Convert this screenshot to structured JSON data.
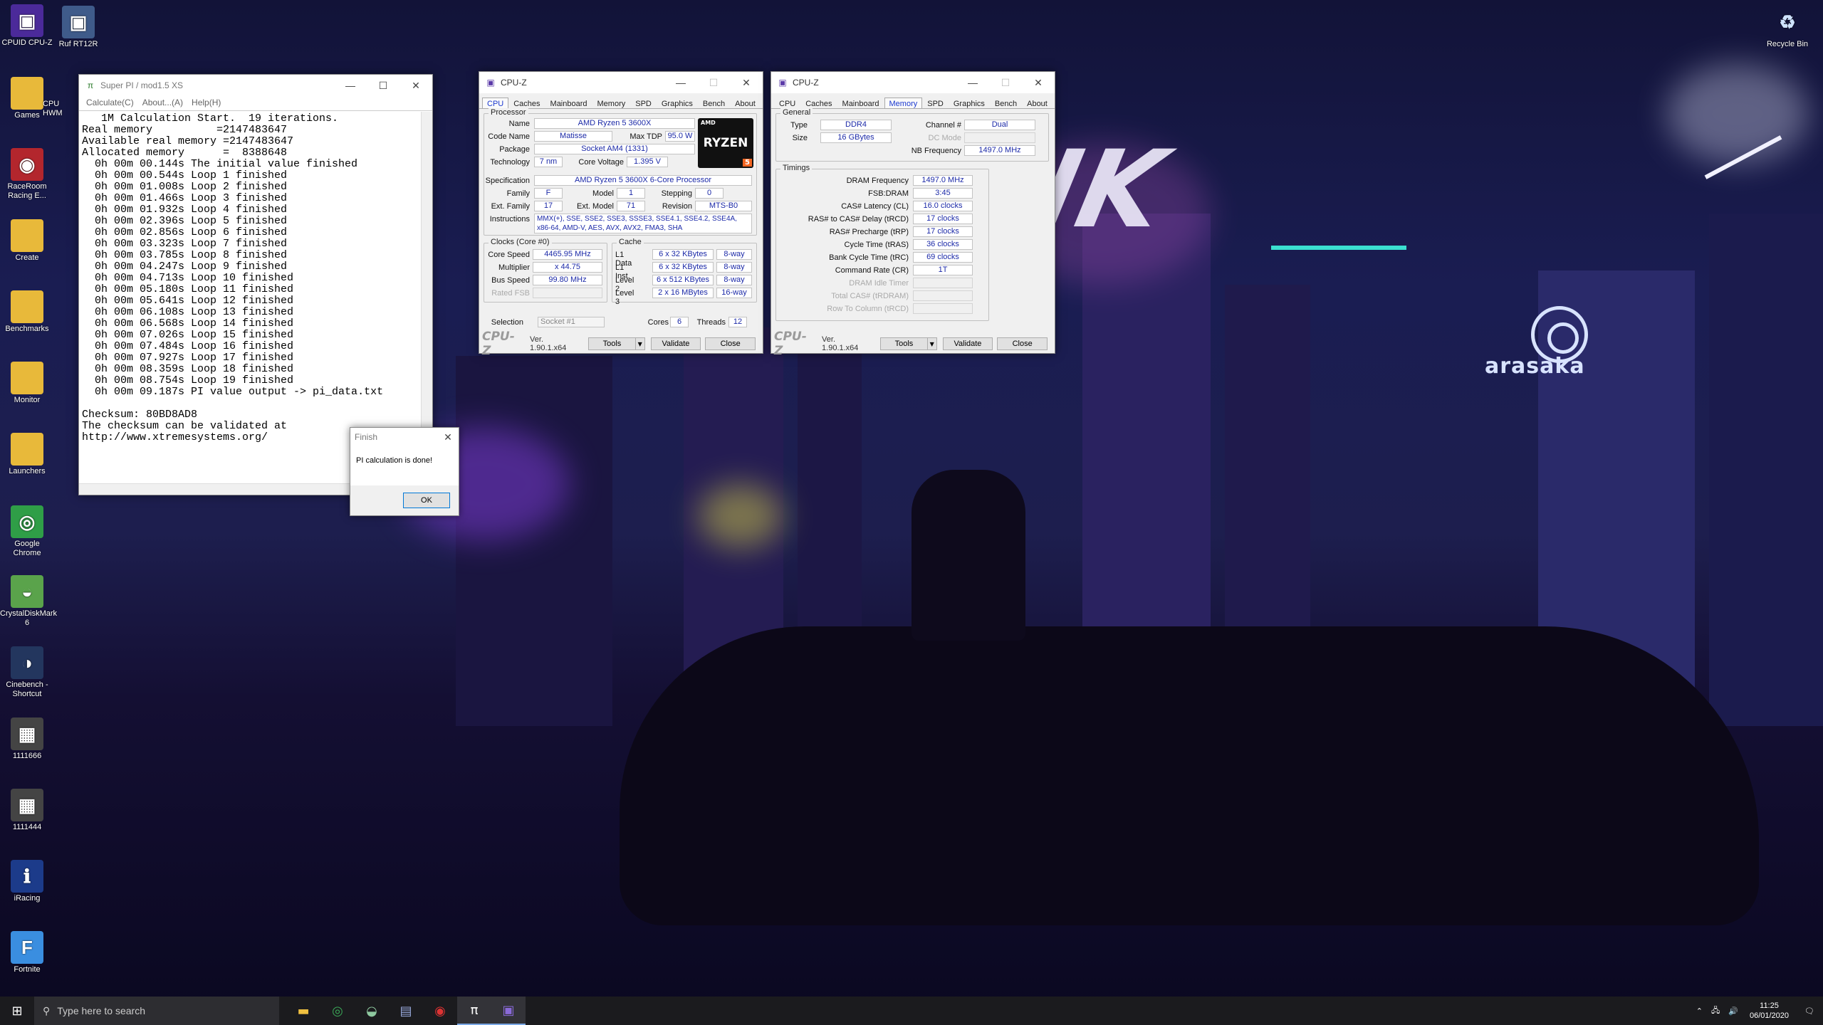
{
  "desktop": {
    "icons_left": [
      {
        "label": "CPUID CPU-Z",
        "icon": "cpuz-icon"
      },
      {
        "label": "Games",
        "icon": "folder-icon"
      },
      {
        "label": "RaceRoom Racing E...",
        "icon": "raceroom-icon"
      },
      {
        "label": "Create",
        "icon": "folder-icon"
      },
      {
        "label": "Benchmarks",
        "icon": "folder-icon"
      },
      {
        "label": "Monitor",
        "icon": "folder-icon"
      },
      {
        "label": "Launchers",
        "icon": "folder-icon"
      },
      {
        "label": "Google Chrome",
        "icon": "chrome-icon"
      },
      {
        "label": "CrystalDiskMark 6",
        "icon": "crystaldisk-icon"
      },
      {
        "label": "Cinebench - Shortcut",
        "icon": "cinebench-icon"
      },
      {
        "label": "1111666",
        "icon": "image-icon"
      },
      {
        "label": "1111444",
        "icon": "image-icon"
      },
      {
        "label": "iRacing",
        "icon": "iracing-icon"
      },
      {
        "label": "Fortnite",
        "icon": "fortnite-icon"
      }
    ],
    "icon_ruf": "Ruf RT12R",
    "icon_cpu_hwm_partial": "CPU HWM",
    "recycle_bin": "Recycle Bin",
    "bg_sign": "NK",
    "arasaka": "arasaka"
  },
  "superpi": {
    "title": "Super PI / mod1.5 XS",
    "menu": [
      "Calculate(C)",
      "About...(A)",
      "Help(H)"
    ],
    "output": "   1M Calculation Start.  19 iterations.\nReal memory          =2147483647\nAvailable real memory =2147483647\nAllocated memory      =  8388648\n  0h 00m 00.144s The initial value finished\n  0h 00m 00.544s Loop 1 finished\n  0h 00m 01.008s Loop 2 finished\n  0h 00m 01.466s Loop 3 finished\n  0h 00m 01.932s Loop 4 finished\n  0h 00m 02.396s Loop 5 finished\n  0h 00m 02.856s Loop 6 finished\n  0h 00m 03.323s Loop 7 finished\n  0h 00m 03.785s Loop 8 finished\n  0h 00m 04.247s Loop 9 finished\n  0h 00m 04.713s Loop 10 finished\n  0h 00m 05.180s Loop 11 finished\n  0h 00m 05.641s Loop 12 finished\n  0h 00m 06.108s Loop 13 finished\n  0h 00m 06.568s Loop 14 finished\n  0h 00m 07.026s Loop 15 finished\n  0h 00m 07.484s Loop 16 finished\n  0h 00m 07.927s Loop 17 finished\n  0h 00m 08.359s Loop 18 finished\n  0h 00m 08.754s Loop 19 finished\n  0h 00m 09.187s PI value output -> pi_data.txt\n\nChecksum: 80BD8AD8\nThe checksum can be validated at\nhttp://www.xtremesystems.org/"
  },
  "dialog": {
    "title": "Finish",
    "message": "PI calculation is done!",
    "ok": "OK"
  },
  "cpuz1": {
    "title": "CPU-Z",
    "tabs": [
      "CPU",
      "Caches",
      "Mainboard",
      "Memory",
      "SPD",
      "Graphics",
      "Bench",
      "About"
    ],
    "active_tab": "CPU",
    "processor_group": "Processor",
    "labels": {
      "name": "Name",
      "code_name": "Code Name",
      "max_tdp": "Max TDP",
      "package": "Package",
      "technology": "Technology",
      "core_voltage": "Core Voltage",
      "specification": "Specification",
      "family": "Family",
      "model": "Model",
      "stepping": "Stepping",
      "ext_family": "Ext. Family",
      "ext_model": "Ext. Model",
      "revision": "Revision",
      "instructions": "Instructions"
    },
    "values": {
      "name": "AMD Ryzen 5 3600X",
      "code_name": "Matisse",
      "max_tdp": "95.0 W",
      "package": "Socket AM4 (1331)",
      "technology": "7 nm",
      "core_voltage": "1.395 V",
      "specification": "AMD Ryzen 5 3600X 6-Core Processor",
      "family": "F",
      "model": "1",
      "stepping": "0",
      "ext_family": "17",
      "ext_model": "71",
      "revision": "MTS-B0",
      "instructions": "MMX(+), SSE, SSE2, SSE3, SSSE3, SSE4.1, SSE4.2, SSE4A, x86-64, AMD-V, AES, AVX, AVX2, FMA3, SHA"
    },
    "logo": {
      "top": "AMD",
      "main": "RYZEN",
      "badge": "5"
    },
    "clocks_group": "Clocks (Core #0)",
    "clocks": {
      "core_speed_label": "Core Speed",
      "core_speed": "4465.95 MHz",
      "multiplier_label": "Multiplier",
      "multiplier": "x 44.75",
      "bus_speed_label": "Bus Speed",
      "bus_speed": "99.80 MHz",
      "rated_fsb_label": "Rated FSB"
    },
    "cache_group": "Cache",
    "cache": [
      {
        "label": "L1 Data",
        "size": "6 x 32 KBytes",
        "way": "8-way"
      },
      {
        "label": "L1 Inst.",
        "size": "6 x 32 KBytes",
        "way": "8-way"
      },
      {
        "label": "Level 2",
        "size": "6 x 512 KBytes",
        "way": "8-way"
      },
      {
        "label": "Level 3",
        "size": "2 x 16 MBytes",
        "way": "16-way"
      }
    ],
    "selection_label": "Selection",
    "selection": "Socket #1",
    "cores_label": "Cores",
    "cores": "6",
    "threads_label": "Threads",
    "threads": "12",
    "footer": {
      "logo": "CPU-Z",
      "version": "Ver. 1.90.1.x64",
      "tools": "Tools",
      "validate": "Validate",
      "close": "Close"
    }
  },
  "cpuz2": {
    "title": "CPU-Z",
    "tabs": [
      "CPU",
      "Caches",
      "Mainboard",
      "Memory",
      "SPD",
      "Graphics",
      "Bench",
      "About"
    ],
    "active_tab": "Memory",
    "general_group": "General",
    "general": {
      "type_label": "Type",
      "type": "DDR4",
      "size_label": "Size",
      "size": "16 GBytes",
      "channel_label": "Channel #",
      "channel": "Dual",
      "dc_mode_label": "DC Mode",
      "nb_freq_label": "NB Frequency",
      "nb_freq": "1497.0 MHz"
    },
    "timings_group": "Timings",
    "timings": [
      {
        "label": "DRAM Frequency",
        "value": "1497.0 MHz",
        "dim": false
      },
      {
        "label": "FSB:DRAM",
        "value": "3:45",
        "dim": false
      },
      {
        "label": "CAS# Latency (CL)",
        "value": "16.0 clocks",
        "dim": false
      },
      {
        "label": "RAS# to CAS# Delay (tRCD)",
        "value": "17 clocks",
        "dim": false
      },
      {
        "label": "RAS# Precharge (tRP)",
        "value": "17 clocks",
        "dim": false
      },
      {
        "label": "Cycle Time (tRAS)",
        "value": "36 clocks",
        "dim": false
      },
      {
        "label": "Bank Cycle Time (tRC)",
        "value": "69 clocks",
        "dim": false
      },
      {
        "label": "Command Rate (CR)",
        "value": "1T",
        "dim": false
      },
      {
        "label": "DRAM Idle Timer",
        "value": "",
        "dim": true
      },
      {
        "label": "Total CAS# (tRDRAM)",
        "value": "",
        "dim": true
      },
      {
        "label": "Row To Column (tRCD)",
        "value": "",
        "dim": true
      }
    ],
    "footer": {
      "logo": "CPU-Z",
      "version": "Ver. 1.90.1.x64",
      "tools": "Tools",
      "validate": "Validate",
      "close": "Close"
    }
  },
  "taskbar": {
    "search_placeholder": "Type here to search",
    "pinned": [
      "file-explorer-icon",
      "chrome-icon",
      "crystaldisk-icon",
      "notepad-icon",
      "raceroom-icon",
      "superpi-icon",
      "cpuz-icon"
    ],
    "time": "11:25",
    "date": "06/01/2020"
  }
}
